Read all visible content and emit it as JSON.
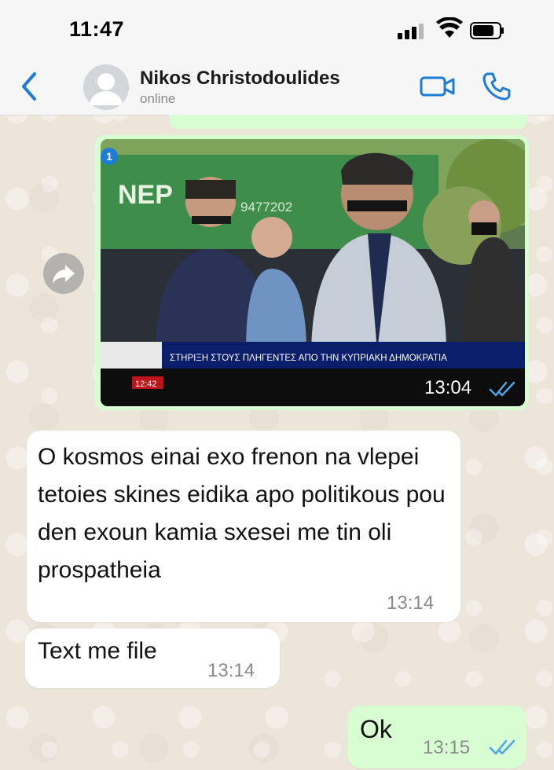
{
  "status_bar": {
    "time": "11:47"
  },
  "header": {
    "contact_name": "Nikos Christodoulides",
    "contact_status": "online"
  },
  "messages": [
    {
      "type": "image",
      "direction": "outgoing",
      "view_once_badge": "1",
      "image_description": "TV news screenshot with three men",
      "overlay": {
        "caption": "ΣΤΗΡΙΞΗ ΣΤΟΥΣ ΠΛΗΓΕΝΤΕΣ ΑΠΟ ΤΗΝ ΚΥΠΡΙΑΚΗ ΔΗΜΟΚΡΑΤΙΑ",
        "clock": "12:42",
        "truck_text": "NEP",
        "truck_number": "9477202"
      },
      "time": "13:04",
      "read": true
    },
    {
      "type": "text",
      "direction": "incoming",
      "text": "O kosmos einai exo frenon na vlepei tetoies skines eidika apo politikous pou den exoun kamia sxesei me tin oli prospatheia",
      "time": "13:14"
    },
    {
      "type": "text",
      "direction": "incoming",
      "text": "Text me file",
      "time": "13:14"
    },
    {
      "type": "text",
      "direction": "outgoing",
      "text": "Ok",
      "time": "13:15",
      "read": true
    }
  ],
  "colors": {
    "accent": "#1c7cd6",
    "outgoing_bubble": "#d9fdd3",
    "incoming_bubble": "#ffffff",
    "read_ticks": "#4fa3e8",
    "chat_background": "#ece5da"
  },
  "icons": [
    "chevron-left-icon",
    "avatar-icon",
    "video-camera-icon",
    "phone-icon",
    "forward-icon",
    "double-check-icon",
    "signal-icon",
    "wifi-icon",
    "battery-icon"
  ]
}
